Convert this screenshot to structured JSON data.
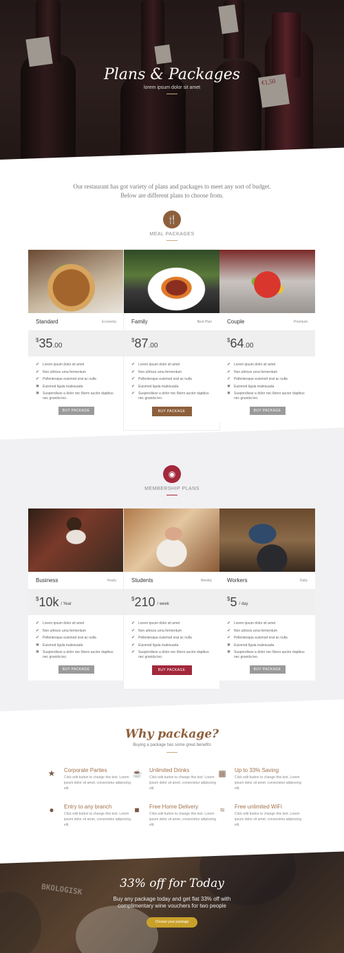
{
  "hero": {
    "title": "Plans & Packages",
    "subtitle": "lorem ipsum dolor sit amet",
    "tags": [
      "",
      "",
      "",
      "€1,50"
    ]
  },
  "intro": "Our restaurant has got variety of plans and packages to meet any sort of budget. Below are different plans to choose from.",
  "meal_section": {
    "icon": "fork-knife-icon",
    "title": "MEAL PACKAGES",
    "accent": "#8e5f3b",
    "cards": [
      {
        "name": "Standard",
        "tag": "Economy",
        "currency": "$",
        "amount": "35",
        "decimal": ".00",
        "per": "",
        "button": "BUY PACKAGE",
        "featured": false,
        "features": [
          {
            "text": "Lorem ipsum dolor sit amet",
            "on": true
          },
          {
            "text": "Non ultrices urna fermentum",
            "on": true
          },
          {
            "text": "Pellentesque euismod erat ac nulla",
            "on": true
          },
          {
            "text": "Euismod ligula malesuada",
            "on": false
          },
          {
            "text": "Suspendisse a dolor nec libero auctor dapibus nec gravida leo.",
            "on": false
          }
        ]
      },
      {
        "name": "Family",
        "tag": "Best Plan",
        "currency": "$",
        "amount": "87",
        "decimal": ".00",
        "per": "",
        "button": "BUY PACKAGE",
        "featured": true,
        "features": [
          {
            "text": "Lorem ipsum dolor sit amet",
            "on": true
          },
          {
            "text": "Non ultrices urna fermentum",
            "on": true
          },
          {
            "text": "Pellentesque euismod erat ac nulla",
            "on": true
          },
          {
            "text": "Euismod ligula malesuada",
            "on": true
          },
          {
            "text": "Suspendisse a dolor nec libero auctor dapibus nec gravida leo.",
            "on": true
          }
        ]
      },
      {
        "name": "Couple",
        "tag": "Premium",
        "currency": "$",
        "amount": "64",
        "decimal": ".00",
        "per": "",
        "button": "BUY PACKAGE",
        "featured": false,
        "features": [
          {
            "text": "Lorem ipsum dolor sit amet",
            "on": true
          },
          {
            "text": "Non ultrices urna fermentum",
            "on": true
          },
          {
            "text": "Pellentesque euismod erat ac nulla",
            "on": true
          },
          {
            "text": "Euismod ligula malesuada",
            "on": false
          },
          {
            "text": "Suspendisse a dolor nec libero auctor dapibus nec gravida leo.",
            "on": false
          }
        ]
      }
    ]
  },
  "membership_section": {
    "icon": "group-icon",
    "title": "MEMBERSHIP PLANS",
    "accent": "#a3283b",
    "cards": [
      {
        "name": "Business",
        "tag": "Yearly",
        "currency": "$",
        "amount": "10k",
        "decimal": "",
        "per": "/ Year",
        "button": "BUY PACKAGE",
        "featured": false,
        "features": [
          {
            "text": "Lorem ipsum dolor sit amet",
            "on": true
          },
          {
            "text": "Non ultrices urna fermentum",
            "on": true
          },
          {
            "text": "Pellentesque euismod erat ac nulla",
            "on": true
          },
          {
            "text": "Euismod ligula malesuada",
            "on": false
          },
          {
            "text": "Suspendisse a dolor nec libero auctor dapibus nec gravida leo.",
            "on": false
          }
        ]
      },
      {
        "name": "Students",
        "tag": "Weekly",
        "currency": "$",
        "amount": "210",
        "decimal": "",
        "per": "/ week",
        "button": "BUY PACKAGE",
        "featured": true,
        "features": [
          {
            "text": "Lorem ipsum dolor sit amet",
            "on": true
          },
          {
            "text": "Non ultrices urna fermentum",
            "on": true
          },
          {
            "text": "Pellentesque euismod erat ac nulla",
            "on": true
          },
          {
            "text": "Euismod ligula malesuada",
            "on": true
          },
          {
            "text": "Suspendisse a dolor nec libero auctor dapibus nec gravida leo.",
            "on": true
          }
        ]
      },
      {
        "name": "Workers",
        "tag": "Daily",
        "currency": "$",
        "amount": "5",
        "decimal": "",
        "per": "/ day",
        "button": "BUY PACKAGE",
        "featured": false,
        "features": [
          {
            "text": "Lorem ipsum dolor sit amet",
            "on": true
          },
          {
            "text": "Non ultrices urna fermentum",
            "on": true
          },
          {
            "text": "Pellentesque euismod erat ac nulla",
            "on": true
          },
          {
            "text": "Euismod ligula malesuada",
            "on": false
          },
          {
            "text": "Suspendisse a dolor nec libero auctor dapibus nec gravida leo.",
            "on": false
          }
        ]
      }
    ]
  },
  "why": {
    "title": "Why package?",
    "subtitle": "Buying a package has some great benefits",
    "features": [
      {
        "icon": "star-icon",
        "title": "Corporate Parties",
        "desc": "Click edit button to change this text. Lorem ipsum dolor sit amet, consectetur adipiscing elit."
      },
      {
        "icon": "coffee-cup-icon",
        "title": "Unlimited Drinks",
        "desc": "Click edit button to change this text. Lorem ipsum dolor sit amet, consectetur adipiscing elit."
      },
      {
        "icon": "money-icon",
        "title": "Up to 33% Saving",
        "desc": "Click edit button to change this text. Lorem ipsum dolor sit amet, consectetur adipiscing elit."
      },
      {
        "icon": "globe-icon",
        "title": "Entry to any branch",
        "desc": "Click edit button to change this text. Lorem ipsum dolor sit amet, consectetur adipiscing elit."
      },
      {
        "icon": "truck-icon",
        "title": "Free Home Delivery",
        "desc": "Click edit button to change this text. Lorem ipsum dolor sit amet, consectetur adipiscing elit."
      },
      {
        "icon": "wifi-icon",
        "title": "Free unlimited WiFi",
        "desc": "Click edit button to change this text. Lorem ipsum dolor sit amet, consectetur adipiscing elit."
      }
    ]
  },
  "offer": {
    "title": "33% off for Today",
    "text": "Buy any package today and get flat 33% off with complimentary wine vouchers for two people",
    "button": "Choose your package",
    "brand_text": "BKOLOGISK"
  }
}
